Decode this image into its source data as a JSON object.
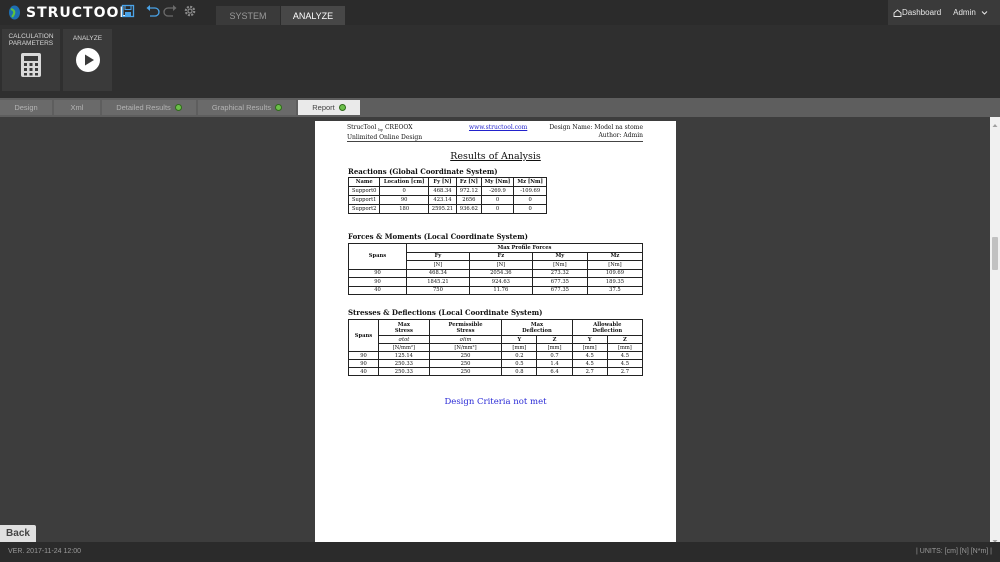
{
  "app": {
    "name": "STRUCTOOL"
  },
  "top_tabs": [
    {
      "label": "SYSTEM",
      "active": false
    },
    {
      "label": "ANALYZE",
      "active": true
    }
  ],
  "top_right": {
    "dashboard": "Dashboard",
    "user": "Admin"
  },
  "ribbon": {
    "calc": "CALCULATION PARAMETERS",
    "analyze": "ANALYZE"
  },
  "sub_tabs": [
    {
      "label": "Design"
    },
    {
      "label": "Xml"
    },
    {
      "label": "Detailed Results"
    },
    {
      "label": "Graphical Results"
    },
    {
      "label": "Report"
    }
  ],
  "report": {
    "header_left_1": "StrucTool",
    "header_left_by": "by",
    "header_left_brand": "CREOOX",
    "header_left_2": "Unlimited Online Design",
    "header_link": "www.structool.com",
    "header_right_1": "Design Name: Model na stome",
    "header_right_2": "Author: Admin",
    "title": "Results of Analysis",
    "reactions": {
      "heading": "Reactions (Global Coordinate System)",
      "columns": [
        "Name",
        "Location [cm]",
        "Fy [N]",
        "Fz [N]",
        "My [Nm]",
        "Mz [Nm]"
      ],
      "rows": [
        [
          "Support0",
          "0",
          "468.34",
          "972.12",
          "-269.9",
          "-109.69"
        ],
        [
          "Support1",
          "90",
          "423.14",
          "2656",
          "0",
          "0"
        ],
        [
          "Support2",
          "180",
          "2595.21",
          "936.62",
          "0",
          "0"
        ]
      ]
    },
    "forces": {
      "heading": "Forces & Moments (Local Coordinate System)",
      "spans": "Spans",
      "group": "Max Profile Forces",
      "columns": [
        "Fy",
        "Fz",
        "My",
        "Mz"
      ],
      "units": [
        "[N]",
        "[N]",
        "[Nm]",
        "[Nm]"
      ],
      "rows": [
        [
          "90",
          "468.34",
          "2054.36",
          "273.32",
          "109.69"
        ],
        [
          "90",
          "1845.21",
          "924.63",
          "677.35",
          "189.35"
        ],
        [
          "40",
          "750",
          "11.76",
          "677.35",
          "37.5"
        ]
      ]
    },
    "stresses": {
      "heading": "Stresses & Deflections (Local Coordinate System)",
      "spans": "Spans",
      "max_stress_1": "Max",
      "max_stress_2": "Stress",
      "perm_stress_1": "Permissible",
      "perm_stress_2": "Stress",
      "max_defl_1": "Max",
      "max_defl_2": "Deflection",
      "allow_defl_1": "Allowable",
      "allow_defl_2": "Deflection",
      "sigma_tot": "σtot",
      "sigma_lim": "σlim",
      "stress_unit": "[N/mm²]",
      "y": "Y",
      "z": "Z",
      "mm": "[mm]",
      "rows": [
        [
          "90",
          "125.14",
          "250",
          "0.2",
          "0.7",
          "4.5",
          "4.5"
        ],
        [
          "90",
          "250.33",
          "250",
          "0.5",
          "1.4",
          "4.5",
          "4.5"
        ],
        [
          "40",
          "250.33",
          "250",
          "0.8",
          "6.4",
          "2.7",
          "2.7"
        ]
      ]
    },
    "criteria": "Design Criteria not met"
  },
  "back": "Back",
  "footer": {
    "version": "VER. 2017-11-24 12:00",
    "units": "| UNITS: [cm] [N] [N*m] |"
  },
  "colors": {
    "accent_green": "#6cc04a",
    "link_blue": "#2b2bd6"
  }
}
